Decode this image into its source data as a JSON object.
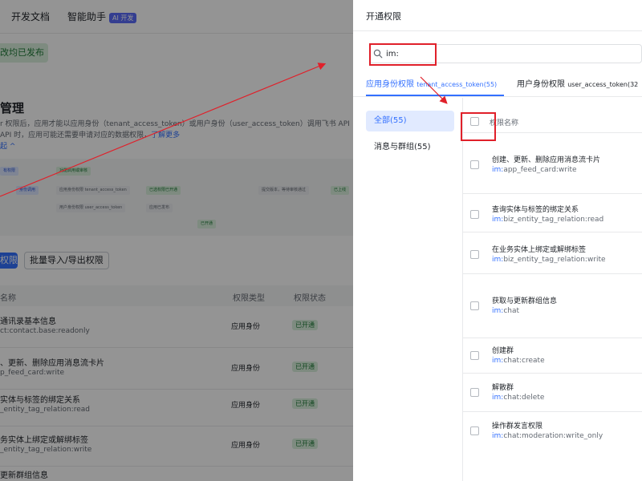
{
  "bg": {
    "nav": [
      "开发文档",
      "智能助手"
    ],
    "ai_badge": "AI 开发",
    "published": "改均已发布",
    "perm_title": "管理",
    "perm_desc_1": "r 权限后，应用才能以应用身份（tenant_access_token）或用户身份（user_access_token）调用飞书 API",
    "perm_desc_2": "API 时，应用可能还需要申请对应的数据权限，",
    "perm_desc_link": "了解更多",
    "perm_desc_3": "起 ^",
    "flow_chips": [
      "有权限",
      "功能启用或审核",
      "身份调用",
      "应用身份权限 tenant_access_token",
      "用户身份权限 user_access_token",
      "已选权限已开通",
      "提交版本，等待审核通过",
      "已上线",
      "应用已发布",
      "已开通"
    ],
    "btn_perm": "权限",
    "btn_batch": "批量导入/导出权限",
    "col_name": "名称",
    "col_type": "权限类型",
    "col_status": "权限状态",
    "rows": [
      {
        "name": "通讯录基本信息",
        "scope": "ct:contact.base:readonly",
        "type": "应用身份",
        "status": "已开通"
      },
      {
        "name": "、更新、删除应用消息流卡片",
        "scope": "p_feed_card:write",
        "type": "应用身份",
        "status": "已开通"
      },
      {
        "name": "实体与标签的绑定关系",
        "scope": "_entity_tag_relation:read",
        "type": "应用身份",
        "status": "已开通"
      },
      {
        "name": "务实体上绑定或解绑标签",
        "scope": "_entity_tag_relation:write",
        "type": "应用身份",
        "status": "已开通"
      },
      {
        "name": "更新群组信息",
        "scope": "",
        "type": "",
        "status": ""
      }
    ]
  },
  "drawer": {
    "title": "开通权限",
    "search_value": "im:",
    "tab_app": "应用身份权限",
    "tab_app_sub": "tenant_access_token(55)",
    "tab_user": "用户身份权限",
    "tab_user_sub": "user_access_token(32",
    "cat_all": "全部(55)",
    "cat_msg": "消息与群组(55)",
    "list_header": "权限名称",
    "items": [
      {
        "name": "创建、更新、删除应用消息流卡片",
        "scope_prefix": "im:",
        "scope_rest": "app_feed_card:write"
      },
      {
        "name": "查询实体与标签的绑定关系",
        "scope_prefix": "im:",
        "scope_rest": "biz_entity_tag_relation:read"
      },
      {
        "name": "在业务实体上绑定或解绑标签",
        "scope_prefix": "im:",
        "scope_rest": "biz_entity_tag_relation:write"
      },
      {
        "name": "获取与更新群组信息",
        "scope_prefix": "im:",
        "scope_rest": "chat"
      },
      {
        "name": "创建群",
        "scope_prefix": "im:",
        "scope_rest": "chat:create"
      },
      {
        "name": "解散群",
        "scope_prefix": "im:",
        "scope_rest": "chat:delete"
      },
      {
        "name": "操作群发言权限",
        "scope_prefix": "im:",
        "scope_rest": "chat:moderation:write_only"
      }
    ]
  },
  "colors": {
    "accent": "#3370ff",
    "annotation": "#e0202a",
    "success": "#1f7a38"
  }
}
